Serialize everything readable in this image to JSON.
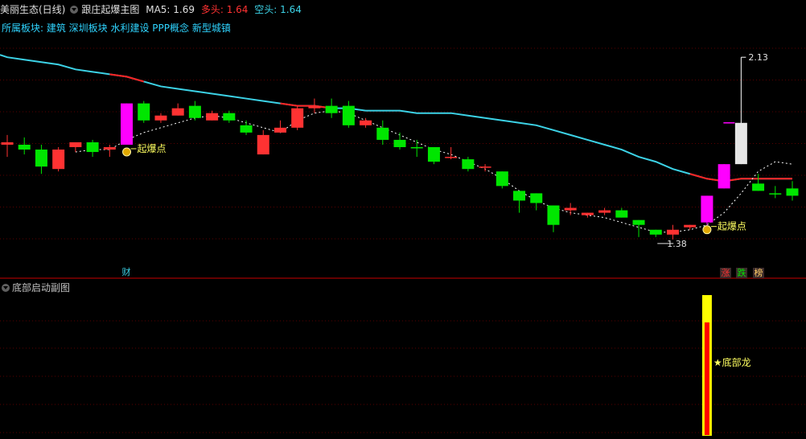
{
  "header": {
    "stock": "美丽生态(日线)",
    "main_indicator": "跟庄起爆主图",
    "ma5_label": "MA5:",
    "ma5_value": "1.69",
    "duo_label": "多头:",
    "duo_value": "1.64",
    "kong_label": "空头:",
    "kong_value": "1.64"
  },
  "sector_line": "所属板块: 建筑 深圳板块 水利建设 PPP概念 新型城镇",
  "sub_panel": {
    "title": "底部启动副图",
    "signal_label": "★底部龙"
  },
  "markers": {
    "qibao": "起爆点",
    "high_label": "2.13",
    "low_label": "1.38",
    "cai": "财",
    "zhang": "涨",
    "die": "跌",
    "bang": "榜"
  },
  "colors": {
    "up": "#ff3232",
    "down": "#00e600",
    "signal": "#ff00ff",
    "ma_long": "#3cd2e6",
    "ma_long_red": "#ff2020",
    "bottom_yellow": "#ffff00",
    "bottom_red": "#ff0000"
  },
  "chart_data": {
    "type": "candlestick",
    "ylim": [
      1.3,
      2.22
    ],
    "candles": [
      {
        "o": 1.77,
        "h": 1.81,
        "l": 1.72,
        "c": 1.78,
        "color": "up"
      },
      {
        "o": 1.77,
        "h": 1.8,
        "l": 1.73,
        "c": 1.75,
        "color": "down"
      },
      {
        "o": 1.75,
        "h": 1.77,
        "l": 1.65,
        "c": 1.68,
        "color": "down"
      },
      {
        "o": 1.75,
        "h": 1.76,
        "l": 1.66,
        "c": 1.67,
        "color": "up"
      },
      {
        "o": 1.76,
        "h": 1.78,
        "l": 1.74,
        "c": 1.78,
        "color": "up"
      },
      {
        "o": 1.78,
        "h": 1.79,
        "l": 1.72,
        "c": 1.74,
        "color": "down"
      },
      {
        "o": 1.75,
        "h": 1.77,
        "l": 1.72,
        "c": 1.76,
        "color": "up"
      },
      {
        "o": 1.77,
        "h": 1.94,
        "l": 1.77,
        "c": 1.94,
        "color": "signal"
      },
      {
        "o": 1.94,
        "h": 1.95,
        "l": 1.86,
        "c": 1.87,
        "color": "down"
      },
      {
        "o": 1.87,
        "h": 1.9,
        "l": 1.86,
        "c": 1.89,
        "color": "up"
      },
      {
        "o": 1.92,
        "h": 1.94,
        "l": 1.89,
        "c": 1.89,
        "color": "up"
      },
      {
        "o": 1.93,
        "h": 1.95,
        "l": 1.87,
        "c": 1.88,
        "color": "down"
      },
      {
        "o": 1.87,
        "h": 1.91,
        "l": 1.87,
        "c": 1.9,
        "color": "up"
      },
      {
        "o": 1.9,
        "h": 1.91,
        "l": 1.86,
        "c": 1.87,
        "color": "down"
      },
      {
        "o": 1.85,
        "h": 1.87,
        "l": 1.81,
        "c": 1.82,
        "color": "down"
      },
      {
        "o": 1.73,
        "h": 1.83,
        "l": 1.73,
        "c": 1.81,
        "color": "up"
      },
      {
        "o": 1.82,
        "h": 1.87,
        "l": 1.82,
        "c": 1.84,
        "color": "up"
      },
      {
        "o": 1.84,
        "h": 1.93,
        "l": 1.83,
        "c": 1.92,
        "color": "up"
      },
      {
        "o": 1.92,
        "h": 1.96,
        "l": 1.9,
        "c": 1.93,
        "color": "up"
      },
      {
        "o": 1.93,
        "h": 1.96,
        "l": 1.88,
        "c": 1.9,
        "color": "down"
      },
      {
        "o": 1.93,
        "h": 1.95,
        "l": 1.84,
        "c": 1.85,
        "color": "down"
      },
      {
        "o": 1.85,
        "h": 1.88,
        "l": 1.84,
        "c": 1.87,
        "color": "up"
      },
      {
        "o": 1.84,
        "h": 1.87,
        "l": 1.77,
        "c": 1.79,
        "color": "down"
      },
      {
        "o": 1.79,
        "h": 1.82,
        "l": 1.75,
        "c": 1.76,
        "color": "down"
      },
      {
        "o": 1.76,
        "h": 1.79,
        "l": 1.72,
        "c": 1.76,
        "color": "down"
      },
      {
        "o": 1.76,
        "h": 1.76,
        "l": 1.69,
        "c": 1.7,
        "color": "down"
      },
      {
        "o": 1.72,
        "h": 1.76,
        "l": 1.71,
        "c": 1.72,
        "color": "up"
      },
      {
        "o": 1.71,
        "h": 1.72,
        "l": 1.66,
        "c": 1.67,
        "color": "down"
      },
      {
        "o": 1.68,
        "h": 1.69,
        "l": 1.66,
        "c": 1.68,
        "color": "up"
      },
      {
        "o": 1.66,
        "h": 1.66,
        "l": 1.59,
        "c": 1.6,
        "color": "down"
      },
      {
        "o": 1.58,
        "h": 1.58,
        "l": 1.49,
        "c": 1.54,
        "color": "down"
      },
      {
        "o": 1.57,
        "h": 1.57,
        "l": 1.5,
        "c": 1.53,
        "color": "down"
      },
      {
        "o": 1.52,
        "h": 1.52,
        "l": 1.41,
        "c": 1.44,
        "color": "down"
      },
      {
        "o": 1.5,
        "h": 1.53,
        "l": 1.48,
        "c": 1.51,
        "color": "up"
      },
      {
        "o": 1.48,
        "h": 1.49,
        "l": 1.47,
        "c": 1.49,
        "color": "up"
      },
      {
        "o": 1.49,
        "h": 1.51,
        "l": 1.48,
        "c": 1.5,
        "color": "up"
      },
      {
        "o": 1.5,
        "h": 1.51,
        "l": 1.47,
        "c": 1.47,
        "color": "down"
      },
      {
        "o": 1.46,
        "h": 1.46,
        "l": 1.39,
        "c": 1.44,
        "color": "down"
      },
      {
        "o": 1.42,
        "h": 1.42,
        "l": 1.39,
        "c": 1.4,
        "color": "down"
      },
      {
        "o": 1.4,
        "h": 1.44,
        "l": 1.38,
        "c": 1.42,
        "color": "up"
      },
      {
        "o": 1.43,
        "h": 1.44,
        "l": 1.42,
        "c": 1.44,
        "color": "up"
      },
      {
        "o": 1.45,
        "h": 1.56,
        "l": 1.44,
        "c": 1.56,
        "color": "signal"
      },
      {
        "o": 1.59,
        "h": 1.69,
        "l": 1.59,
        "c": 1.69,
        "color": "signal"
      },
      {
        "o": 1.69,
        "h": 2.13,
        "l": 1.69,
        "c": 1.86,
        "color": "white"
      },
      {
        "o": 1.61,
        "h": 1.65,
        "l": 1.58,
        "c": 1.58,
        "color": "down"
      },
      {
        "o": 1.57,
        "h": 1.6,
        "l": 1.55,
        "c": 1.57,
        "color": "down"
      },
      {
        "o": 1.59,
        "h": 1.62,
        "l": 1.54,
        "c": 1.56,
        "color": "down"
      }
    ],
    "ma_long": [
      2.13,
      2.12,
      2.11,
      2.1,
      2.08,
      2.07,
      2.06,
      2.05,
      2.03,
      2.01,
      2.0,
      1.99,
      1.98,
      1.97,
      1.96,
      1.95,
      1.94,
      1.93,
      1.93,
      1.92,
      1.92,
      1.91,
      1.91,
      1.91,
      1.9,
      1.9,
      1.9,
      1.89,
      1.88,
      1.87,
      1.86,
      1.85,
      1.83,
      1.81,
      1.79,
      1.77,
      1.75,
      1.72,
      1.7,
      1.67,
      1.65,
      1.63,
      1.62,
      1.63,
      1.63,
      1.63,
      1.63
    ],
    "ma_dotted": [
      null,
      null,
      null,
      null,
      1.74,
      1.75,
      1.75,
      1.79,
      1.82,
      1.84,
      1.86,
      1.88,
      1.89,
      1.88,
      1.86,
      1.84,
      1.82,
      1.87,
      1.9,
      1.91,
      1.9,
      1.87,
      1.84,
      1.81,
      1.78,
      1.75,
      1.73,
      1.7,
      1.67,
      1.63,
      1.58,
      1.54,
      1.51,
      1.49,
      1.48,
      1.47,
      1.45,
      1.43,
      1.41,
      1.41,
      1.42,
      1.44,
      1.49,
      1.57,
      1.66,
      1.7,
      1.69
    ],
    "bottom_signal_index": 41
  }
}
